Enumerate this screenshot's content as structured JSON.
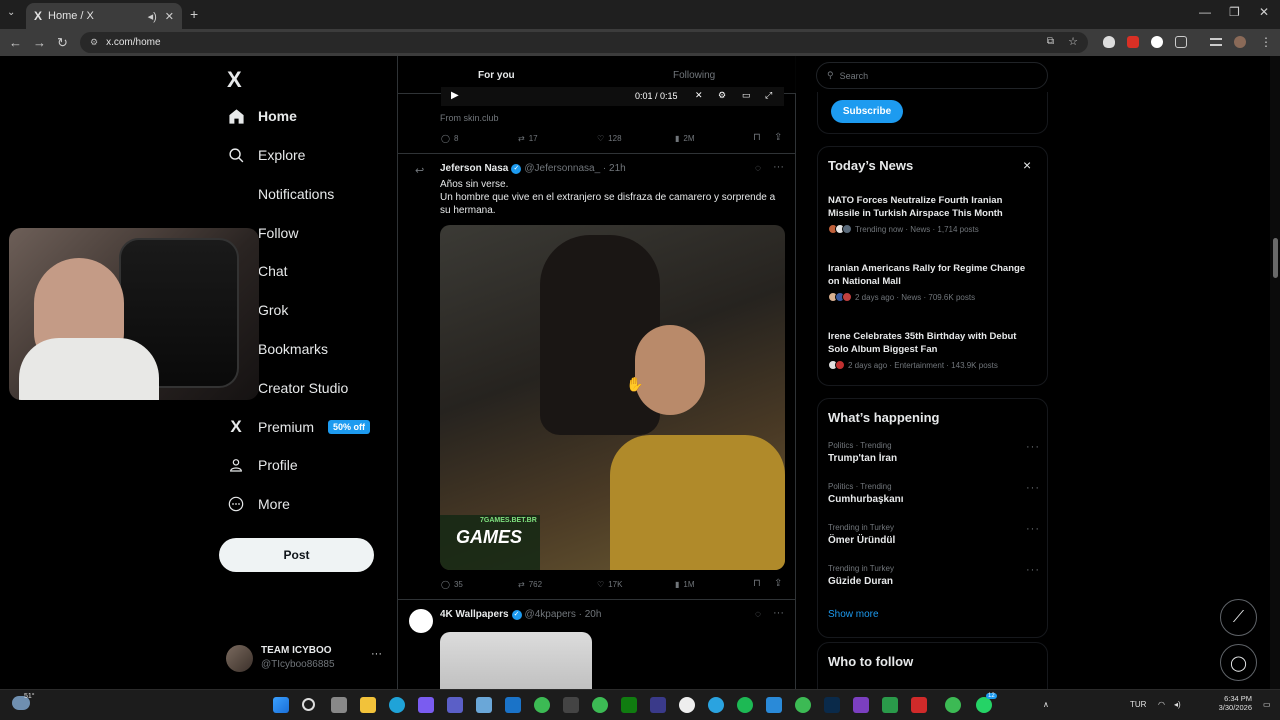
{
  "browser": {
    "tab_title": "Home / X",
    "tab_favicon": "X",
    "url": "x.com/home"
  },
  "sidebar": {
    "logo": "X",
    "items": [
      {
        "label": "Home",
        "icon": "home-icon"
      },
      {
        "label": "Explore",
        "icon": "search-icon"
      },
      {
        "label": "Notifications",
        "icon": "bell-icon"
      },
      {
        "label": "Follow",
        "icon": "person-plus-icon"
      },
      {
        "label": "Chat",
        "icon": "chat-icon"
      },
      {
        "label": "Grok",
        "icon": "grok-icon"
      },
      {
        "label": "Bookmarks",
        "icon": "bookmark-icon"
      },
      {
        "label": "Creator Studio",
        "icon": "rocket-icon"
      },
      {
        "label": "Premium",
        "icon": "x-icon"
      },
      {
        "label": "Profile",
        "icon": "person-icon"
      },
      {
        "label": "More",
        "icon": "more-circle-icon"
      }
    ],
    "premium_badge": "50% off",
    "post_label": "Post",
    "account": {
      "name": "TEAM ICYBOO",
      "handle": "@TIcyboo86885",
      "more": "···"
    }
  },
  "feed": {
    "tabs": {
      "for_you": "For you",
      "following": "Following"
    },
    "video_time": "0:01 / 0:15",
    "post1": {
      "source": "From skin.club",
      "replies": "8",
      "reposts": "17",
      "likes": "128",
      "views": "2M"
    },
    "post2": {
      "name": "Jeferson Nasa",
      "handle": "@Jefersonnasa_ · 21h",
      "line1": "Años sin verse.",
      "line2": "Un hombre que vive en el extranjero se disfraza de camarero y sorprende a su hermana.",
      "media_watermark": "7GAMES.BET.BR",
      "media_logo": "GAMES",
      "replies": "35",
      "reposts": "762",
      "likes": "17K",
      "views": "1M"
    },
    "post3": {
      "name": "4K Wallpapers",
      "handle": "@4kpapers · 20h"
    }
  },
  "right": {
    "search_placeholder": "Search",
    "subscribe_label": "Subscribe",
    "news": {
      "header": "Today’s News",
      "close": "×",
      "items": [
        {
          "title": "NATO Forces Neutralize Fourth Iranian Missile in Turkish Airspace This Month",
          "meta": "Trending now · News · 1,714 posts"
        },
        {
          "title": "Iranian Americans Rally for Regime Change on National Mall",
          "meta": "2 days ago · News · 709.6K posts"
        },
        {
          "title": "Irene Celebrates 35th Birthday with Debut Solo Album Biggest Fan",
          "meta": "2 days ago · Entertainment · 143.9K posts"
        }
      ]
    },
    "happening": {
      "header": "What’s happening",
      "items": [
        {
          "context": "Politics · Trending",
          "title": "Trump'tan İran"
        },
        {
          "context": "Politics · Trending",
          "title": "Cumhurbaşkanı"
        },
        {
          "context": "Trending in Turkey",
          "title": "Ömer Üründül"
        },
        {
          "context": "Trending in Turkey",
          "title": "Güzide Duran"
        }
      ],
      "show_more": "Show more"
    },
    "who_to_follow": "Who to follow"
  },
  "taskbar": {
    "weather": "51°",
    "lang": "TUR",
    "time": "6:34 PM",
    "date": "3/30/2026",
    "whatsapp_badge": "12"
  },
  "colors": {
    "accent": "#1d9bf0",
    "bg": "#000000",
    "text": "#e7e9ea",
    "muted": "#71767b",
    "border": "#2f3336"
  }
}
